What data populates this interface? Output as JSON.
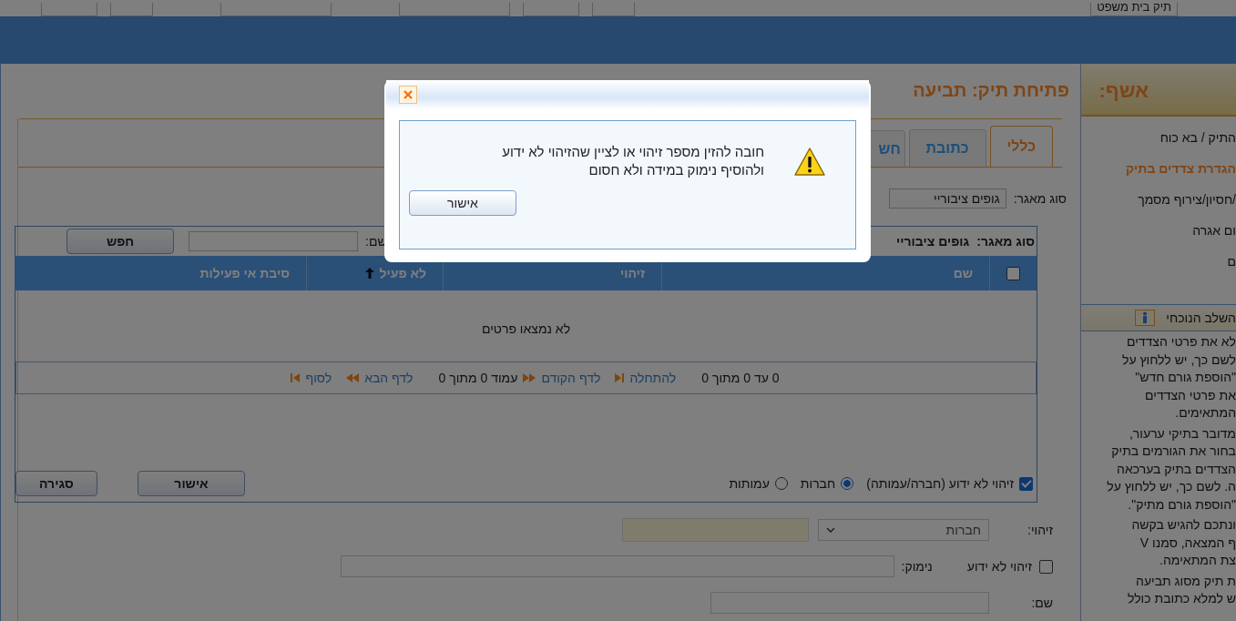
{
  "top_bar": {
    "case_type": "תיק בית משפט"
  },
  "page_title": "פתיחת תיק: תביעה",
  "tabs": [
    {
      "label": "כללי",
      "selected": true
    },
    {
      "label": "כתובת",
      "selected": false
    },
    {
      "label": "חש",
      "selected": false
    }
  ],
  "source_filter": {
    "label": "סוג מאגר:",
    "value": "גופים ציבוריי"
  },
  "search_box": {
    "source_label": "סוג מאגר:",
    "source_value": "גופים ציבוריי",
    "name_label": "שם:",
    "search_button": "חפש",
    "select_all": {
      "checked": false
    },
    "columns": [
      {
        "label": "שם",
        "sorted_ascending": false
      },
      {
        "label": "זיהוי",
        "sorted_ascending": false
      },
      {
        "label": "לא פעיל",
        "sorted_ascending": true
      },
      {
        "label": "סיבת אי פעילות",
        "sorted_ascending": false
      }
    ],
    "empty_message": "לא נמצאו פרטים",
    "pager": {
      "range": "0 עד 0 מתוך 0",
      "first": "להתחלה",
      "prev": "לדף הקודם",
      "page": "עמוד 0 מתוך 0",
      "next": "לדף הבא",
      "last": "לסוף"
    },
    "unknown_id": {
      "label": "זיהוי לא ידוע (חברה/עמותה)",
      "checked": true
    },
    "entity_types": [
      {
        "label": "חברות",
        "selected": true
      },
      {
        "label": "עמותות",
        "selected": false
      }
    ],
    "buttons": [
      "אישור",
      "סגירה"
    ]
  },
  "form": {
    "id_label": "זיהוי:",
    "id_type": "חברות",
    "unknown_id": {
      "label": "זיהוי לא ידוע",
      "checked": false
    },
    "reason_label": "נימוק:",
    "name_label": "שם:"
  },
  "wizard": {
    "title": "אשף:",
    "steps": [
      {
        "label": "התיק / בא כוח",
        "selected": false
      },
      {
        "label": "הגדרת צדדים בתיק",
        "selected": true
      },
      {
        "label": "/חסיון/צירוף מסמך",
        "selected": false
      },
      {
        "label": "ום אגרה",
        "selected": false
      },
      {
        "label": "ם",
        "selected": false
      }
    ],
    "current_step_title": "השלב הנוכחי",
    "paragraphs": [
      [
        "לא את פרטי הצדדים",
        "לשם כך, יש ללחוץ על",
        "\"הוספת גורם חדש\"",
        "את פרטי הצדדים",
        "המתאימים."
      ],
      [
        "מדובר בתיקי ערעור,",
        "בחור את הגורמים בתיק",
        "הצדדים בתיק בערכאה",
        "ה. לשם כך, יש ללחוץ על",
        "\"הוספת גורם מתיק\"."
      ],
      [
        "ונתכם להגיש בקשה",
        "ף המצאה, סמנו V",
        "צת המתאימה."
      ],
      [
        "ת תיק מסוג תביעה",
        "ש למלא כתובת כולל"
      ]
    ]
  },
  "dialog": {
    "message_lines": [
      "חובה להזין מספר זיהוי או לציין שהזיהוי לא ידוע",
      "ולהוסיף נימוק במידה ולא חסום"
    ],
    "ok_button": "אישור"
  }
}
